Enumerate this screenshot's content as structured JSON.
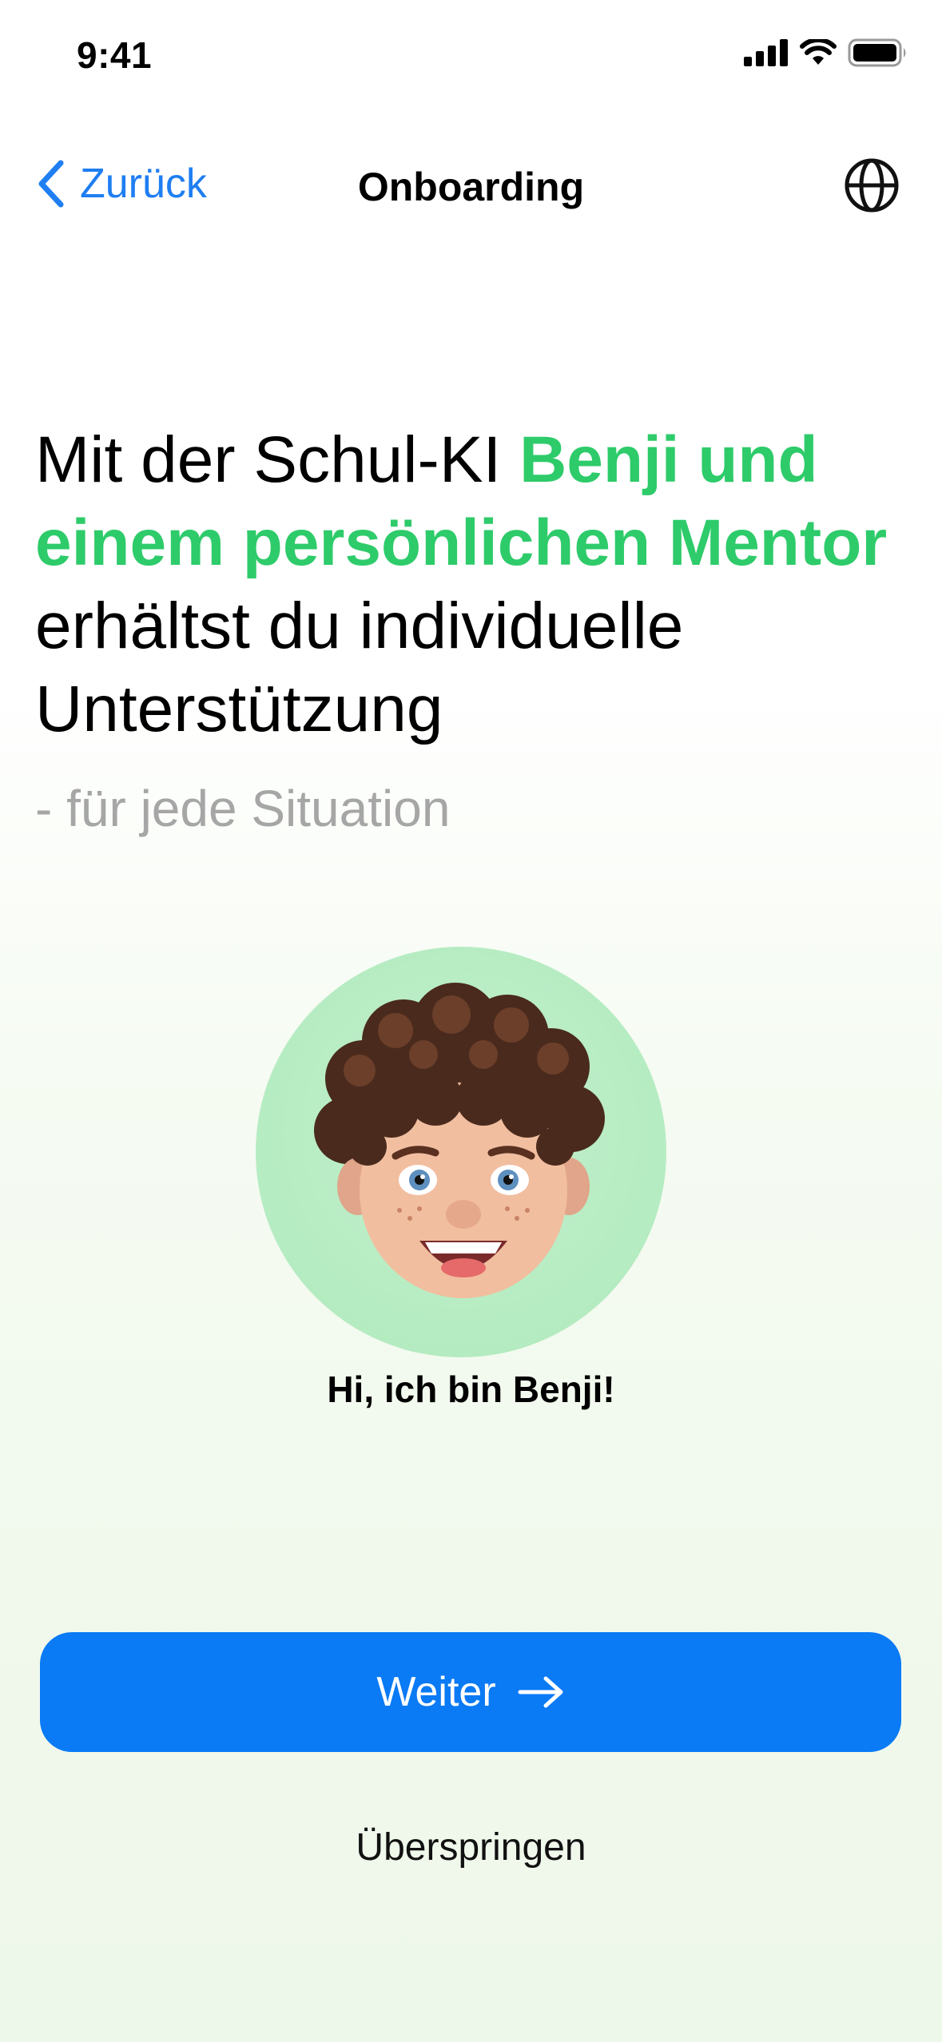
{
  "status_bar": {
    "time": "9:41",
    "icons": [
      "cellular-signal-icon",
      "wifi-icon",
      "battery-icon"
    ]
  },
  "nav": {
    "back_label": "Zurück",
    "title": "Onboarding",
    "globe_icon": "globe-icon"
  },
  "headline": {
    "part1": "Mit der Schul-KI ",
    "accent": "Benji und einem persönlichen Mentor",
    "part2": " erhältst du individuelle  Unterstützung",
    "subline": "- für jede Situation",
    "accent_color": "#2ecb6a"
  },
  "avatar": {
    "caption": "Hi, ich bin Benji!",
    "background_color": "#b6ecc2"
  },
  "actions": {
    "primary_label": "Weiter",
    "primary_icon": "arrow-right-icon",
    "primary_color": "#0a7af5",
    "skip_label": "Überspringen"
  }
}
